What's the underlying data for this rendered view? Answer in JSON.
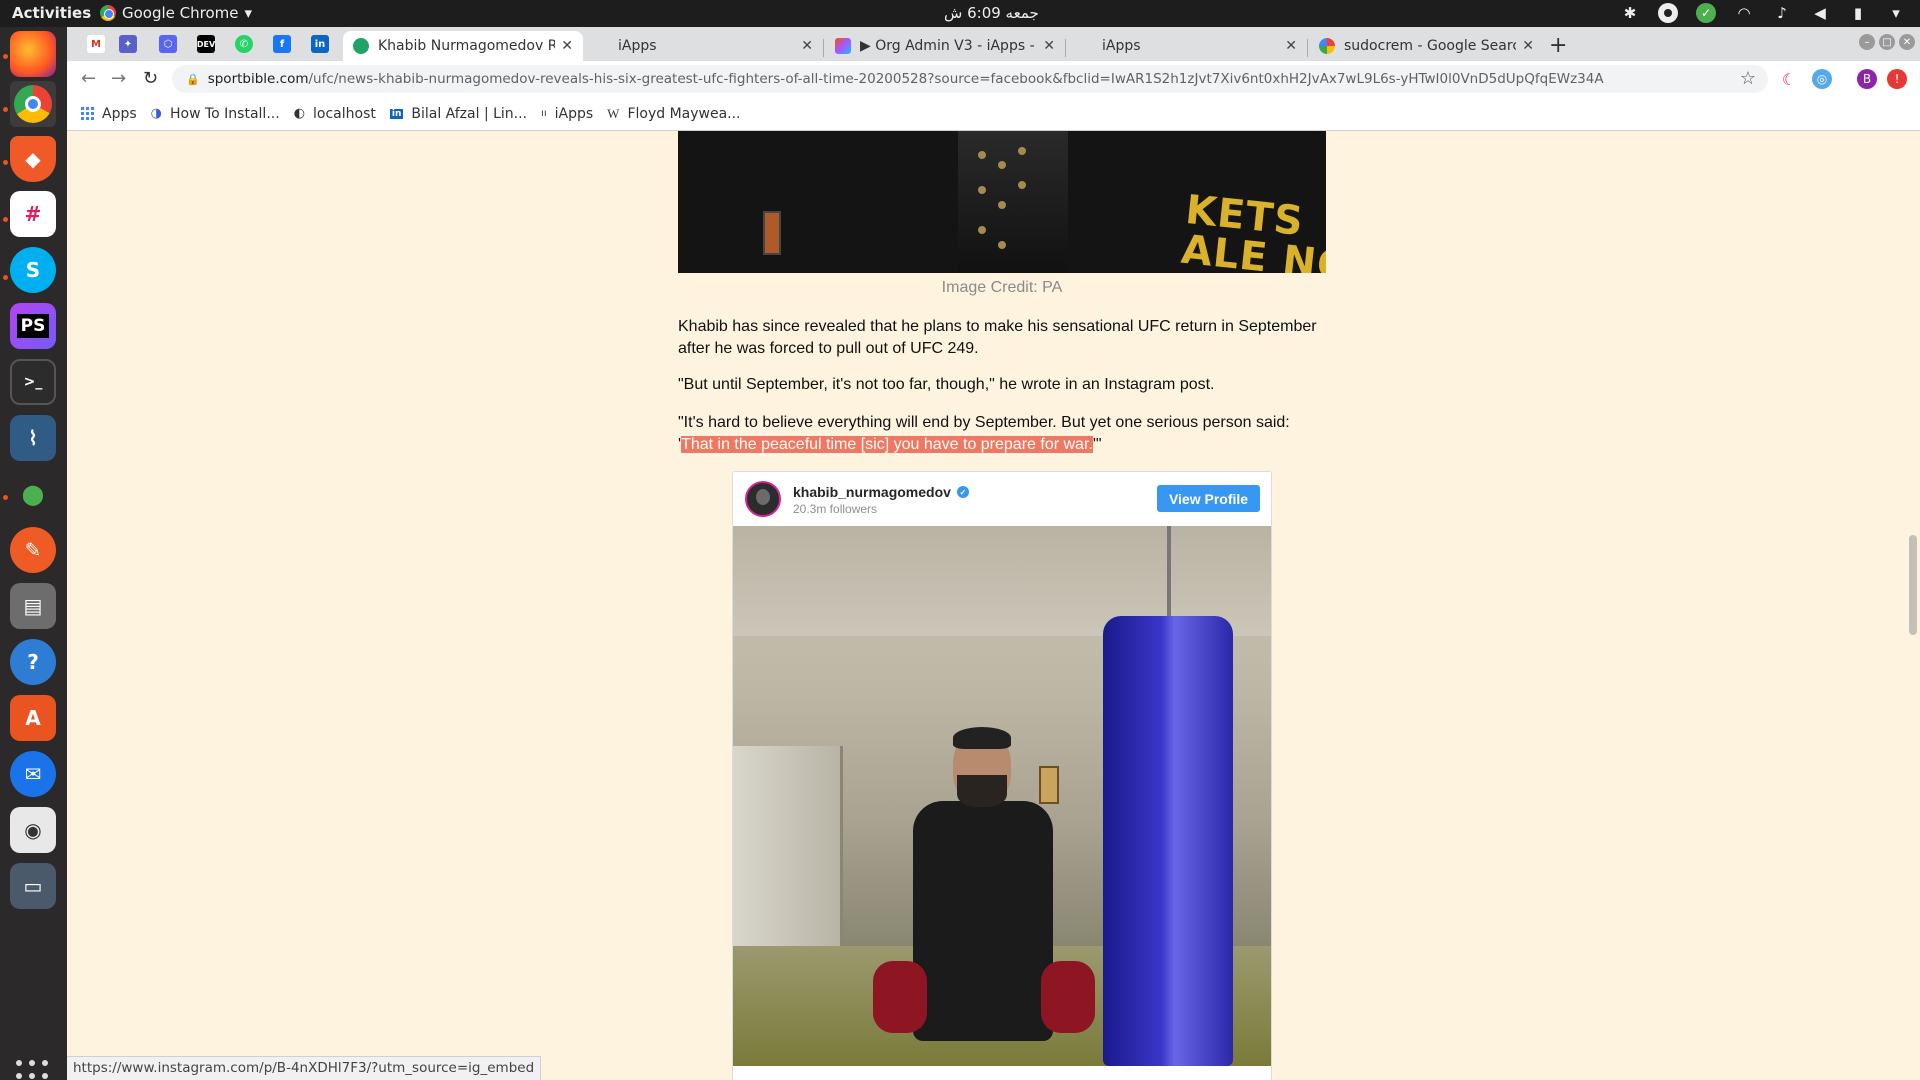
{
  "system_bar": {
    "activities": "Activities",
    "app_name": "Google Chrome",
    "app_arrow": "▾",
    "clock": "جمعه 6:09 ش",
    "tray_icons": [
      "network-icon",
      "status-circle-icon",
      "check-icon",
      "wifi-icon",
      "bell-icon",
      "volume-icon",
      "battery-icon",
      "power-menu-icon"
    ]
  },
  "dock": {
    "apps": [
      "firefox",
      "chrome",
      "brave",
      "slack",
      "skype",
      "phpstorm",
      "terminal",
      "mysql-workbench",
      "robo-3t",
      "postman",
      "files",
      "help",
      "software-center",
      "thunderbird",
      "rhythmbox",
      "screen"
    ]
  },
  "tabs": {
    "pinned": [
      "gmail",
      "extension-1",
      "extension-2",
      "dev",
      "whatsapp",
      "facebook",
      "linkedin"
    ],
    "pinned_labels": [
      "M",
      "✦",
      "⬡",
      "DEV",
      "✆",
      "f",
      "in"
    ],
    "items": [
      {
        "title": "Khabib Nurmagomedov R",
        "active": true,
        "favicon_color": "#21a366"
      },
      {
        "title": "iApps",
        "active": false,
        "favicon_color": ""
      },
      {
        "title": "▶ Org Admin V3 - iApps -",
        "active": false,
        "favicon_color": "#a259ff"
      },
      {
        "title": "iApps",
        "active": false,
        "favicon_color": ""
      },
      {
        "title": "sudocrem - Google Search",
        "active": false,
        "favicon_color": "#4285f4"
      }
    ],
    "close_glyph": "✕",
    "new_tab": "+"
  },
  "toolbar": {
    "url_host": "sportbible.com",
    "url_path": "/ufc/news-khabib-nurmagomedov-reveals-his-six-greatest-ufc-fighters-of-all-time-20200528?source=facebook&fbclid=IwAR1S2h1zJvt7Xiv6nt0xhH2JvAx7wL9L6s-yHTwI0l0VnD5dUpQfqEWz34A",
    "back": "←",
    "forward": "→",
    "reload": "↻",
    "star": "☆",
    "lock": "🔒",
    "profile_initial": "B"
  },
  "bookmarks": [
    {
      "label": "Apps",
      "icon": "apps-grid-icon"
    },
    {
      "label": "How To Install...",
      "icon": "link-icon"
    },
    {
      "label": "localhost",
      "icon": "globe-icon"
    },
    {
      "label": "Bilal Afzal | Lin...",
      "icon": "linkedin-icon"
    },
    {
      "label": "iApps",
      "icon": "iapps-icon"
    },
    {
      "label": "Floyd Maywea...",
      "icon": "wikipedia-icon"
    }
  ],
  "article": {
    "hero_text": "KETS\nALE NOW",
    "image_credit": "Image Credit: PA",
    "para1": "Khabib has since revealed that he plans to make his sensational UFC return in September after he was forced to pull out of UFC 249.",
    "para2": "\"But until September, it's not too far, though,\" he wrote in an Instagram post.",
    "para3_prefix": "\"It's hard to believe everything will end by September. But yet one serious person said: '",
    "para3_highlight": "That in the peaceful time [sic] you have to prepare for war.",
    "para3_suffix": "'\""
  },
  "instagram": {
    "username": "khabib_nurmagomedov",
    "followers": "20.3m followers",
    "view_profile": "View Profile",
    "verified_glyph": "✓"
  },
  "status_url": "https://www.instagram.com/p/B-4nXDHl7F3/?utm_source=ig_embed"
}
